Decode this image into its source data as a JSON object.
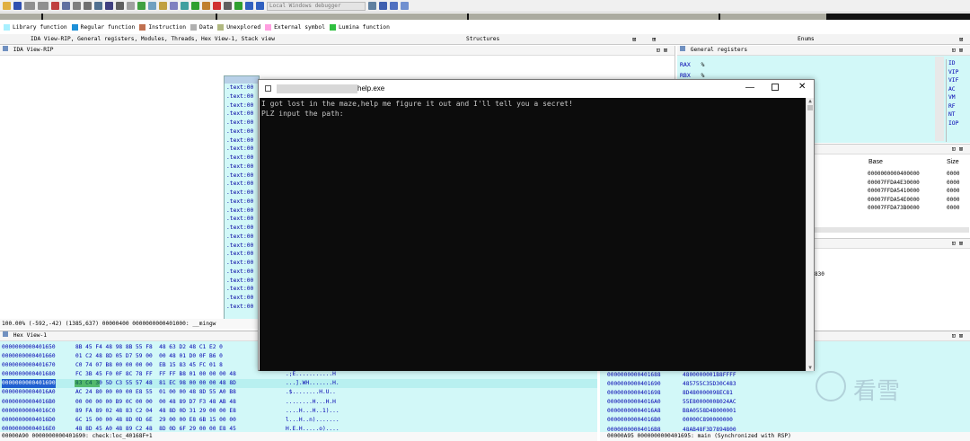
{
  "toolbar": {
    "debugger": "Local Windows debugger",
    "colors": {
      "bg": "#f0f0f0",
      "nav_gray": "#ababa0"
    }
  },
  "legend": [
    {
      "label": "Library function",
      "color": "#a8f0ff"
    },
    {
      "label": "Regular function",
      "color": "#1e90d8"
    },
    {
      "label": "Instruction",
      "color": "#c07050"
    },
    {
      "label": "Data",
      "color": "#b0b0b0"
    },
    {
      "label": "Unexplored",
      "color": "#b0b880"
    },
    {
      "label": "External symbol",
      "color": "#ff9fe0"
    },
    {
      "label": "Lumina function",
      "color": "#30c040"
    }
  ],
  "tabs": {
    "main": "IDA View-RIP, General registers, Modules, Threads, Hex View-1, Stack view",
    "structures": "Structures",
    "enums": "Enums"
  },
  "ida_view": {
    "title": "IDA View-RIP",
    "text_lines": [
      ".text:00",
      ".text:00",
      ".text:00",
      ".text:00",
      ".text:00",
      ".text:00",
      ".text:00",
      ".text:00",
      ".text:00",
      ".text:00",
      ".text:00",
      ".text:00",
      ".text:00",
      ".text:00",
      ".text:00",
      ".text:00",
      ".text:00",
      ".text:00",
      ".text:00",
      ".text:00",
      ".text:00",
      ".text:00",
      ".text:00",
      ".text:00",
      ".text:00",
      ".text:00"
    ],
    "status": "100.00% (-592,-42) (1385,637) 00000400 0000000000401000: __mingw"
  },
  "registers": {
    "title": "General registers",
    "rows": [
      {
        "name": "RAX",
        "value": "%"
      },
      {
        "name": "RBX",
        "value": "%"
      }
    ],
    "flags": [
      "ID",
      "VIP",
      "VIF",
      "AC",
      "VM",
      "RF",
      "NT",
      "IOP"
    ]
  },
  "modules": {
    "headers": {
      "base": "Base",
      "size": "Size"
    },
    "bases": [
      "0000000000400000",
      "00007FFDA4E30000",
      "00007FFDA5410000",
      "00007FFDA54E0000",
      "00007FFDA73B0000"
    ],
    "sizes": [
      "0000",
      "0000",
      "0000",
      "0000",
      "0000"
    ]
  },
  "threads": {
    "fragment": "830"
  },
  "hex_view": {
    "title": "Hex View-1",
    "rows": [
      {
        "addr": "0000000000401650",
        "bytes": "8B 45 F4 48 98 8B 55 F8  48 63 D2 48 C1 E2 0",
        "ascii": ""
      },
      {
        "addr": "0000000000401660",
        "bytes": "01 C2 48 8D 05 D7 59 00  00 48 01 D0 0F B6 0",
        "ascii": ""
      },
      {
        "addr": "0000000000401670",
        "bytes": "C0 74 07 B8 00 00 00 00  EB 15 83 45 FC 01 8",
        "ascii": ""
      },
      {
        "addr": "0000000000401680",
        "bytes": "FC 3B 45 F0 0F 8C 78 FF  FF FF B8 01 00 00 00 48",
        "ascii": ".;E...........H"
      },
      {
        "addr": "0000000000401690",
        "bytes": "83 C4 30 5D C3 55 57 48  81 EC 98 00 00 00 48 8D",
        "ascii": "...].WH.......H."
      },
      {
        "addr": "00000000004016A0",
        "bytes": "AC 24 80 00 00 00 E8 55  01 00 00 48 8D 55 A0 B8",
        "ascii": ".$........H.U.."
      },
      {
        "addr": "00000000004016B0",
        "bytes": "00 00 00 00 B9 0C 00 00  00 48 89 D7 F3 48 AB 48",
        "ascii": "........H...H.H"
      },
      {
        "addr": "00000000004016C0",
        "bytes": "89 FA 89 02 48 83 C2 04  48 8D 0D 31 29 00 00 E8",
        "ascii": "....H...H..1)..."
      },
      {
        "addr": "00000000004016D0",
        "bytes": "6C 15 00 00 48 8D 0D 6E  29 00 00 E8 6B 15 00 00",
        "ascii": "l...H..n)......."
      },
      {
        "addr": "00000000004016E0",
        "bytes": "48 8D 45 A0 48 89 C2 48  8D 0D 6F 29 00 00 E8 45",
        "ascii": "H.E.H.....o)...."
      }
    ],
    "status": "00000A90 0000000000401690: check:loc_40168F+1"
  },
  "stack_view": {
    "rows": [
      {
        "addr": "0000000000401688",
        "value": "4800000001B8FFFF"
      },
      {
        "addr": "0000000000401690",
        "value": "485755C35D30C483"
      },
      {
        "addr": "0000000000401698",
        "value": "8D480000098EC81"
      },
      {
        "addr": "00000000004016A0",
        "value": "55E80000008024AC"
      },
      {
        "addr": "00000000004016A8",
        "value": "B8A0558D48000001"
      },
      {
        "addr": "00000000004016B0",
        "value": "00000C890000000"
      },
      {
        "addr": "00000000004016B8",
        "value": "48AB48F3D7894800"
      }
    ],
    "status": "00000A95 0000000000401695: main (Synchronized with RSP)"
  },
  "console": {
    "title": "help.exe",
    "lines": [
      "I got lost in the maze,help me figure it out and I'll tell you a secret!",
      "PLZ input the path:"
    ]
  },
  "watermark": {
    "text": "看雪"
  }
}
